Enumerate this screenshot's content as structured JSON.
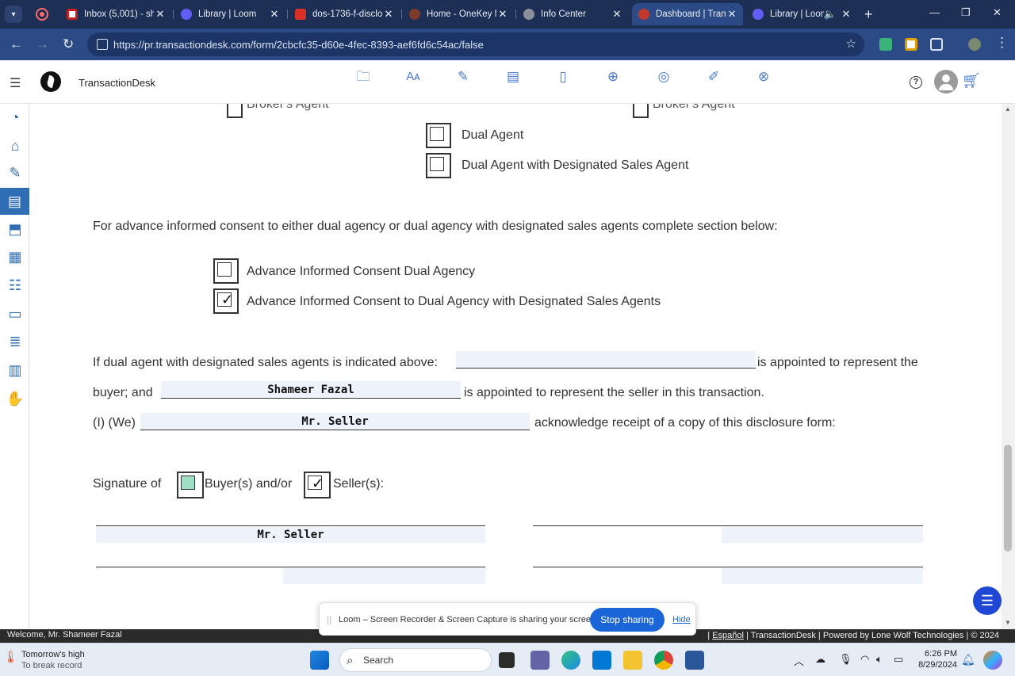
{
  "browser": {
    "tabs": [
      {
        "title": "Inbox (5,001) - sh",
        "fav_color": "#c5221f"
      },
      {
        "title": "Library | Loom",
        "fav_color": "#625df5"
      },
      {
        "title": "dos-1736-f-disclo",
        "fav_color": "#d93025"
      },
      {
        "title": "Home - OneKey M",
        "fav_color": "#7d3b2c"
      },
      {
        "title": "Info Center",
        "fav_color": "#8a8f99"
      },
      {
        "title": "Dashboard | Tran",
        "fav_color": "#c0392b"
      },
      {
        "title": "Library | Loom",
        "fav_color": "#625df5"
      }
    ],
    "url": "https://pr.transactiondesk.com/form/2cbcfc35-d60e-4fec-8393-aef6fd6c54ac/false"
  },
  "app": {
    "brand": "TransactionDesk",
    "help": "?"
  },
  "form": {
    "broker_agent_left": "Broker's Agent",
    "broker_agent_right": "Broker's Agent",
    "dual_agent": "Dual Agent",
    "dual_agent_designated": "Dual Agent with Designated Sales Agent",
    "consent_intro": "For advance informed consent to either dual agency or dual agency with designated sales agents complete section below:",
    "consent_dual": "Advance Informed Consent Dual Agency",
    "consent_designated": "Advance Informed Consent to Dual Agency with Designated Sales Agents",
    "if_dual_text": "If dual agent with designated sales agents is indicated above:",
    "appointed_buyer_text": "is appointed to represent the",
    "buyer_and": "buyer; and",
    "seller_agent_value": "Shameer Fazal",
    "appointed_seller_text": "is appointed to represent the seller in this transaction.",
    "i_we": "(I) (We)",
    "acknowledger_value": "Mr. Seller",
    "acknowledge_text": "acknowledge receipt of a copy of this disclosure form:",
    "signature_of": "Signature of",
    "buyers_andor": "Buyer(s) and/or",
    "sellers": "Seller(s):",
    "signer_name": "Mr. Seller",
    "consent_dual_checked": false,
    "consent_designated_checked": true,
    "seller_checked": true
  },
  "footer": {
    "welcome": "Welcome, Mr. Shameer Fazal",
    "espanol": "Español",
    "rest": " | TransactionDesk | Powered by Lone Wolf Technologies | © 2024"
  },
  "loom": {
    "message": "Loom – Screen Recorder & Screen Capture is sharing your screen.",
    "stop": "Stop sharing",
    "hide": "Hide"
  },
  "taskbar": {
    "weather_title": "Tomorrow's high",
    "weather_sub": "To break record",
    "search": "Search",
    "time": "6:26 PM",
    "date": "8/29/2024"
  }
}
